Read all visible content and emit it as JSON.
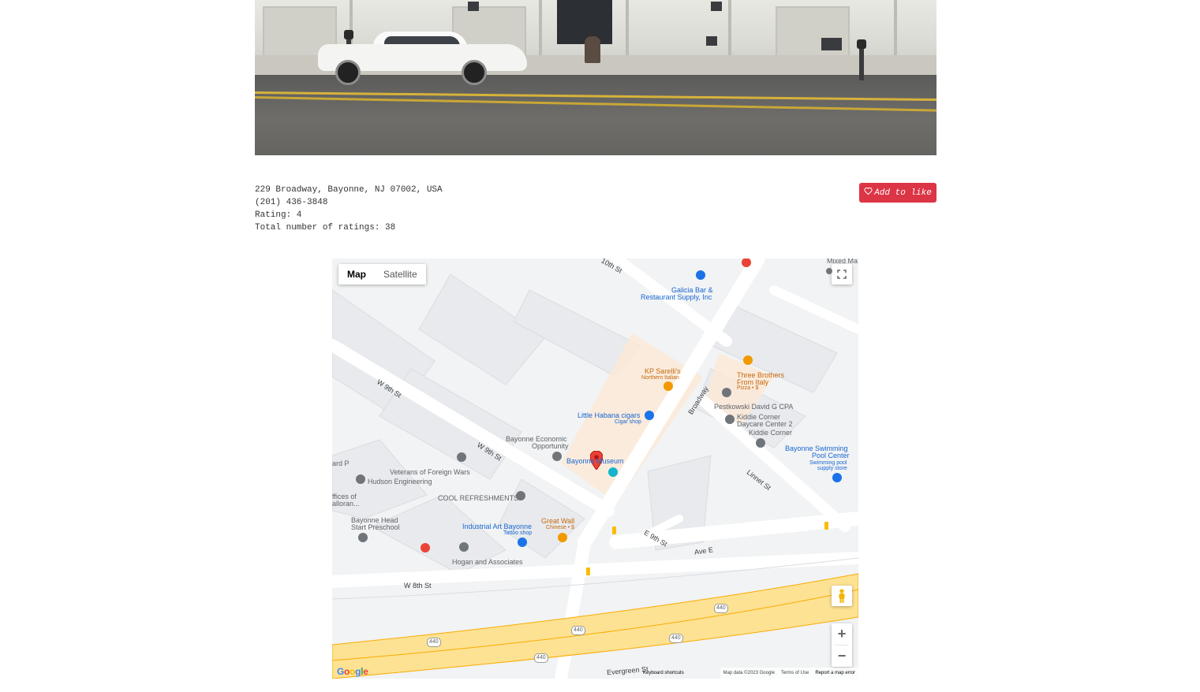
{
  "place": {
    "address": "229 Broadway, Bayonne, NJ 07002, USA",
    "phone": "(201) 436-3848",
    "rating_text": "Rating: 4",
    "total_ratings_text": "Total number of ratings: 38",
    "like_button": "Add to like"
  },
  "map": {
    "type_map": "Map",
    "type_satellite": "Satellite",
    "zoom_in": "+",
    "zoom_out": "−",
    "keyboard_shortcuts": "Keyboard shortcuts",
    "map_data": "Map data ©2023 Google",
    "terms": "Terms of Use",
    "report": "Report a map error",
    "google_logo": "Google",
    "streets": {
      "w9th_a": "W 9th St",
      "w9th_b": "W 9th St",
      "broadway": "Broadway",
      "linnet": "Linnet St",
      "e9th": "E 9th St",
      "ave_e": "Ave E",
      "w8th": "W 8th St",
      "evergreen": "Evergreen St",
      "tenth": "10th St",
      "route": "440"
    },
    "places": {
      "galicia": "Galicia Bar &",
      "galicia2": "Restaurant Supply, Inc",
      "kp": "KP Sarelli's",
      "kp_sub": "Northern Italian",
      "three": "Three Brothers",
      "three2": "From Italy",
      "three_sub": "Pizza • $",
      "pest": "Pestkowski David G CPA",
      "kiddie": "Kiddie Corner",
      "kiddie2": "Daycare Center 2",
      "kiddie3": "Kiddie Corner",
      "habana": "Little Habana cigars",
      "habana_sub": "Cigar shop",
      "econ": "Bayonne Economic",
      "econ2": "Opportunity",
      "museum": "Bayonne Museum",
      "swim": "Bayonne Swimming",
      "swim2": "Pool Center",
      "swim_sub": "Swimming pool",
      "swim_sub2": "supply store",
      "vfw": "Veterans of Foreign Wars",
      "hudson": "Hudson Engineering",
      "cool": "COOL REFRESHMENTS",
      "industrial": "Industrial Art Bayonne",
      "industrial_sub": "Tattoo shop",
      "greatwall": "Great Wall",
      "greatwall_sub": "Chinese • $",
      "headstart": "Bayonne Head",
      "headstart2": "Start Preschool",
      "hogan": "Hogan and Associates",
      "offices": "ffices of",
      "offices2": "alloran...",
      "ard": "ard P",
      "mixed": "Mixed Ma"
    }
  },
  "colors": {
    "like_button": "#dc3545",
    "highway": "#fde293",
    "marker": "#ea4335"
  }
}
